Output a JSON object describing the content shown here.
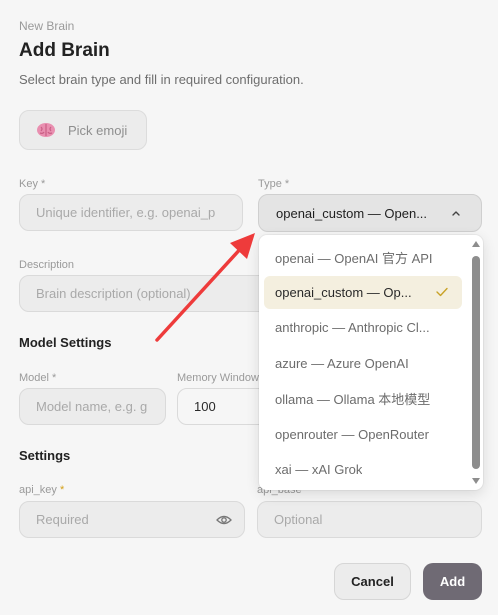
{
  "header": {
    "eyebrow": "New Brain",
    "title": "Add Brain",
    "subtitle": "Select brain type and fill in required configuration."
  },
  "emoji": {
    "label": "Pick emoji"
  },
  "fields": {
    "key": {
      "label": "Key",
      "required": "*",
      "placeholder": "Unique identifier, e.g. openai_p"
    },
    "type": {
      "label": "Type",
      "required": "*",
      "value": "openai_custom — Open..."
    },
    "description": {
      "label": "Description",
      "placeholder": "Brain description (optional)"
    },
    "model": {
      "label": "Model",
      "required": "*",
      "placeholder": "Model name, e.g. g"
    },
    "memory_window": {
      "label": "Memory Window",
      "value": "100"
    },
    "api_key": {
      "label": "api_key",
      "required": "*",
      "placeholder": "Required"
    },
    "api_base": {
      "label": "api_base",
      "placeholder": "Optional"
    }
  },
  "sections": {
    "model_settings": "Model Settings",
    "settings": "Settings"
  },
  "dropdown": {
    "options": [
      {
        "label": "openai — OpenAI 官方 API",
        "selected": false
      },
      {
        "label": "openai_custom — Op...",
        "selected": true
      },
      {
        "label": "anthropic — Anthropic Cl...",
        "selected": false
      },
      {
        "label": "azure — Azure OpenAI",
        "selected": false
      },
      {
        "label": "ollama — Ollama 本地模型",
        "selected": false
      },
      {
        "label": "openrouter — OpenRouter",
        "selected": false
      },
      {
        "label": "xai — xAI Grok",
        "selected": false
      }
    ]
  },
  "buttons": {
    "cancel": "Cancel",
    "add": "Add"
  },
  "colors": {
    "annotation_arrow": "#ee3b3b",
    "selected_option_bg": "#f4efdf",
    "required_asterisk": "#d4a017",
    "add_button": "#6f6a74"
  },
  "icons": [
    "brain-icon",
    "chevron-up-icon",
    "eye-icon",
    "check-icon"
  ]
}
